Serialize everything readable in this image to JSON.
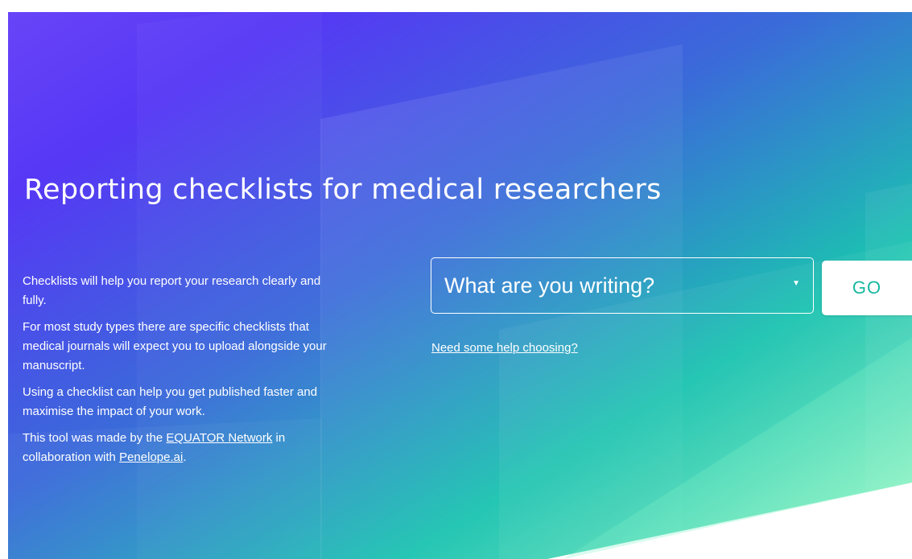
{
  "hero": {
    "title": "Reporting checklists for medical researchers",
    "intro": {
      "p1": "Checklists will help you report your research clearly and fully.",
      "p2": "For most study types there are specific checklists that medical journals will expect you to upload alongside your manuscript.",
      "p3": "Using a checklist can help you get published faster and maximise the impact of your work.",
      "p4_prefix": "This tool was made by the ",
      "p4_link1": "EQUATOR Network",
      "p4_middle": " in collaboration with ",
      "p4_link2": "Penelope.ai",
      "p4_suffix": "."
    },
    "select": {
      "selected": "What are you writing?",
      "caret_icon": "triangle-down-icon"
    },
    "go_button": "GO",
    "help_link": "Need some help choosing?"
  },
  "colors": {
    "gradient_top_left": "#5b3cf7",
    "gradient_bottom_right": "#15d4a4",
    "go_text": "#17b8a0",
    "text": "#ffffff"
  }
}
